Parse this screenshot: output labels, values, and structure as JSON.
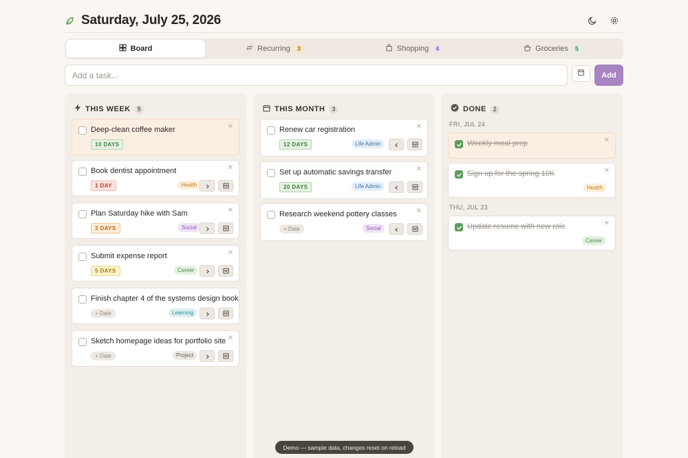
{
  "header": {
    "title": "Saturday, July 25, 2026",
    "accent": "#5c9c5e"
  },
  "tabs": [
    {
      "label": "Board",
      "icon": "board-icon",
      "count": null,
      "active": true
    },
    {
      "label": "Recurring",
      "icon": "repeat-icon",
      "count": "3",
      "active": false
    },
    {
      "label": "Shopping",
      "icon": "bag-icon",
      "count": "4",
      "active": false
    },
    {
      "label": "Groceries",
      "icon": "basket-icon",
      "count": "5",
      "active": false
    }
  ],
  "add_bar": {
    "placeholder": "Add a task...",
    "add_label": "Add",
    "add_color": "#a784c2"
  },
  "columns": {
    "week": {
      "title": "THIS WEEK",
      "count": "5",
      "cards": [
        {
          "title": "Deep-clean coffee maker",
          "due": "10 DAYS",
          "due_style": "green",
          "tag": null,
          "highlight": true
        },
        {
          "title": "Book dentist appointment",
          "due": "1 DAY",
          "due_style": "red",
          "tag": "Health"
        },
        {
          "title": "Plan Saturday hike with Sam",
          "due": "3 DAYS",
          "due_style": "orange",
          "tag": "Social"
        },
        {
          "title": "Submit expense report",
          "due": "5 DAYS",
          "due_style": "yellow",
          "tag": "Career"
        },
        {
          "title": "Finish chapter 4 of the systems design book",
          "date_chip": "+ Date",
          "tag": "Learning"
        },
        {
          "title": "Sketch homepage ideas for portfolio site",
          "date_chip": "+ Date",
          "tag": "Project"
        }
      ]
    },
    "month": {
      "title": "THIS MONTH",
      "count": "3",
      "cards": [
        {
          "title": "Renew car registration",
          "due": "12 DAYS",
          "due_style": "green",
          "tag": "Life Admin"
        },
        {
          "title": "Set up automatic savings transfer",
          "due": "20 DAYS",
          "due_style": "green",
          "tag": "Life Admin"
        },
        {
          "title": "Research weekend pottery classes",
          "date_chip": "+ Date",
          "tag": "Social"
        }
      ]
    },
    "done": {
      "title": "DONE",
      "count": "2",
      "groups": [
        {
          "label": "FRI, JUL 24",
          "cards": [
            {
              "title": "Weekly meal prep",
              "tag": null,
              "highlight": true
            },
            {
              "title": "Sign up for the spring 10K",
              "tag": "Health"
            }
          ]
        },
        {
          "label": "THU, JUL 23",
          "cards": [
            {
              "title": "Update resume with new role",
              "tag": "Career"
            }
          ]
        }
      ]
    }
  },
  "toast": "Demo — sample data, changes reset on reload"
}
